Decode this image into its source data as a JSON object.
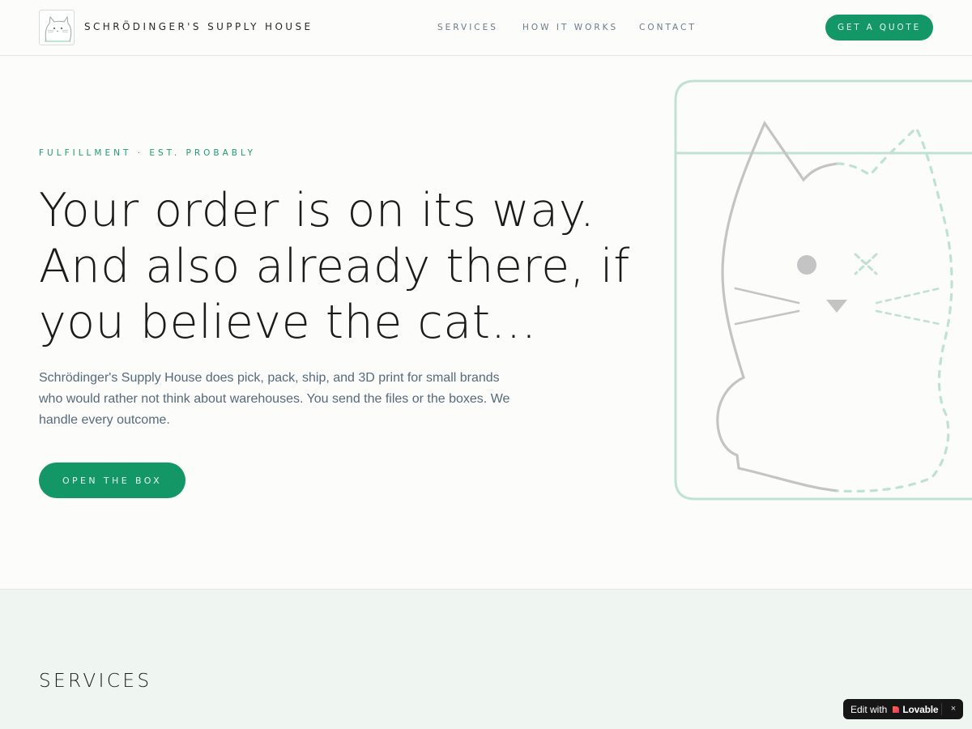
{
  "header": {
    "brand": "SCHRÖDINGER'S SUPPLY HOUSE",
    "nav": [
      "SERVICES",
      "HOW IT WORKS",
      "CONTACT"
    ],
    "cta": "GET A QUOTE"
  },
  "hero": {
    "eyebrow": "FULFILLMENT · EST. PROBABLY",
    "headline": "Your order is on its way. And also already there, if you believe the cat…",
    "lede": "Schrödinger's Supply House does pick, pack, ship, and 3D print for small brands who would rather not think about warehouses. You send the files or the boxes. We handle every outcome.",
    "cta": "OPEN THE BOX"
  },
  "services": {
    "title": "SERVICES"
  },
  "badge": {
    "edit_label": "Edit with",
    "brand": "Lovable",
    "close": "×"
  },
  "colors": {
    "accent": "#149766",
    "eyebrow": "#1f9e6c",
    "box_outline": "#bfe3d3",
    "cat_outline": "#c4c4c4",
    "services_bg": "#eff6f2"
  }
}
